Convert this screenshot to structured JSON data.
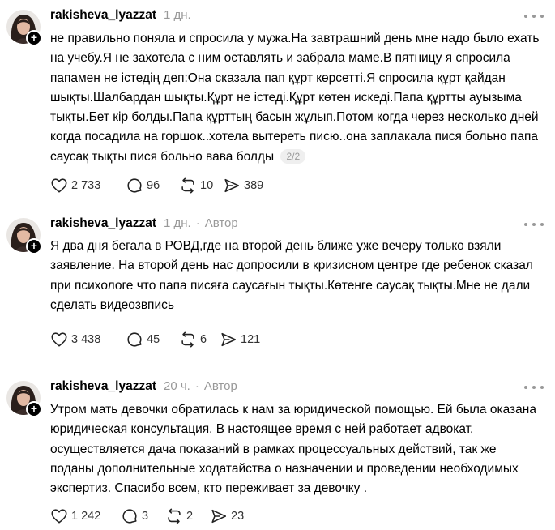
{
  "posts": [
    {
      "username": "rakisheva_lyazzat",
      "time": "1 дн.",
      "author_label": "",
      "text": "не правильно поняла и спросила у мужа.На завтрашний день мне надо было ехать на учебу.Я не захотела с ним оставлять и забрала маме.В пятницу я спросила папамен не істедің деп:Она сказала пап құрт көрсетті.Я спросила құрт қайдан шықты.Шалбардан шықты.Құрт не істеді.Құрт көтен искеді.Папа құртты ауызыма тықты.Бет кір болды.Папа құрттың басын жұлып.Потом когда через несколько дней когда посадила на горшок..хотела вытереть писю..она заплакала пися больно папа саусақ тықты пися больно вава болды",
      "pager": "2/2",
      "likes": "2 733",
      "replies": "96",
      "reposts": "10",
      "shares": "389"
    },
    {
      "username": "rakisheva_lyazzat",
      "time": "1 дн.",
      "author_label": "Автор",
      "text": "Я два дня бегала в РОВД,где на второй день ближе уже вечеру только взяли заявление. На второй день нас допросили в кризисном центре где ребенок сказал при психологе что папа писяға саусағын тықты.Көтенге саусақ тықты.Мне не дали сделать видеозвпись",
      "pager": "",
      "likes": "3 438",
      "replies": "45",
      "reposts": "6",
      "shares": "121"
    },
    {
      "username": "rakisheva_lyazzat",
      "time": "20 ч.",
      "author_label": "Автор",
      "text": "Утром мать девочки обратилась к нам за юридической помощью. Ей была оказана юридическая консультация. В настоящее время с ней работает адвокат, осуществляется дача показаний в рамках процессуальных действий, так же поданы дополнительные ходатайства о назначении и проведении необходимых экспертиз. Спасибо всем, кто переживает за девочку .",
      "pager": "",
      "likes": "1 242",
      "replies": "3",
      "reposts": "2",
      "shares": "23"
    }
  ],
  "separator": "·",
  "icons": {
    "like": "heart-icon",
    "reply": "comment-icon",
    "repost": "repost-icon",
    "share": "share-icon",
    "more": "more-dots-icon",
    "follow": "plus-icon"
  },
  "colors": {
    "text": "#000000",
    "muted": "#999999",
    "divider": "#e6e6e6"
  }
}
